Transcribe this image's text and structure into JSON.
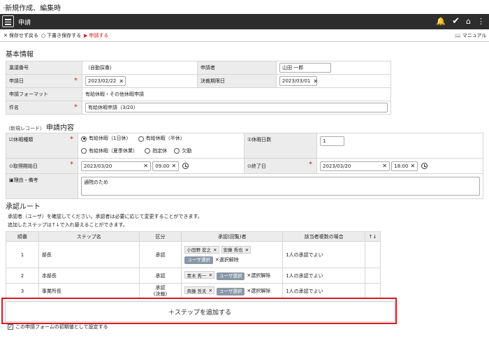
{
  "caption": "·新規作成、編集時",
  "header": {
    "title": "申請",
    "icons": [
      "bell-icon",
      "check-icon",
      "home-icon",
      "more-icon"
    ]
  },
  "toolbar": {
    "save_back": "保存せず戻る",
    "draft": "下書き保存する",
    "apply": "申請する",
    "manual": "マニュアル"
  },
  "basic": {
    "title": "基本情報",
    "ringi_label": "稟議番号",
    "ringi_value": "（自動採番）",
    "applicant_label": "申請者",
    "applicant_value": "山田 一郎",
    "date_label": "申請日",
    "date_value": "2023/02/22",
    "deadline_label": "決裁期限日",
    "deadline_value": "2023/03/01",
    "format_label": "申請フォーマット",
    "format_value": "有給休暇・その他休暇申請",
    "subject_label": "件名",
    "subject_value": "有給休暇申請（3/20）"
  },
  "content": {
    "sub": "（新規レコード）",
    "title": "申請内容",
    "type_label": "休暇種類",
    "types": [
      "有給休暇（1日休）",
      "有給休暇（半休）",
      "有給休暇（夏季休業）",
      "指定休",
      "欠勤"
    ],
    "days_label": "休暇日数",
    "days_value": "1",
    "start_label": "取得開始日",
    "start_date": "2023/03/20",
    "start_time": "09:00",
    "end_label": "終了日",
    "end_date": "2023/03/20",
    "end_time": "18:00",
    "reason_label": "理由・備考",
    "reason_value": "通院のため"
  },
  "route": {
    "title": "承認ルート",
    "desc1": "承認者（ユーザ）を確認してください。承認者は必要に応じて変更することができます。",
    "desc2": "追加したステップは↑↓で入れ替えることができます。",
    "headers": [
      "順番",
      "ステップ名",
      "区分",
      "承認(回覧)者",
      "該当者複数の場合",
      "↑↓"
    ],
    "rows": [
      {
        "no": "1",
        "step": "部長",
        "kind": "承認",
        "users": [
          "小田野 宏之",
          "安藤 秀也"
        ],
        "select": "ユーザ選択",
        "clear": "選択解除",
        "multi": "1人の承認でよい"
      },
      {
        "no": "2",
        "step": "本部長",
        "kind": "承認",
        "users": [
          "青木 秀一"
        ],
        "select": "ユーザ選択",
        "clear": "選択解除",
        "multi": "1人の承認でよい"
      },
      {
        "no": "3",
        "step": "事業所長",
        "kind": "承認",
        "kind2": "(決裁)",
        "users": [
          "斉藤 哲夫"
        ],
        "select": "ユーザ選択",
        "clear": "選択解除",
        "multi": "1人の承認でよい"
      }
    ],
    "add_step": "＋ステップを追加する",
    "default_check": "この申請フォームの初期値として設定する"
  },
  "colors": {
    "topbar": "#2d2d2d",
    "accent_red": "#d21e1e",
    "highlight": "#d7191c"
  }
}
